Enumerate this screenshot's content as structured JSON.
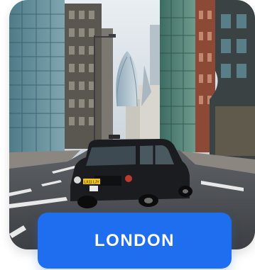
{
  "city_card": {
    "button_label": "LONDON",
    "taxi_plate": "LX11 LJY",
    "accent_color": "#1f6ef0"
  }
}
